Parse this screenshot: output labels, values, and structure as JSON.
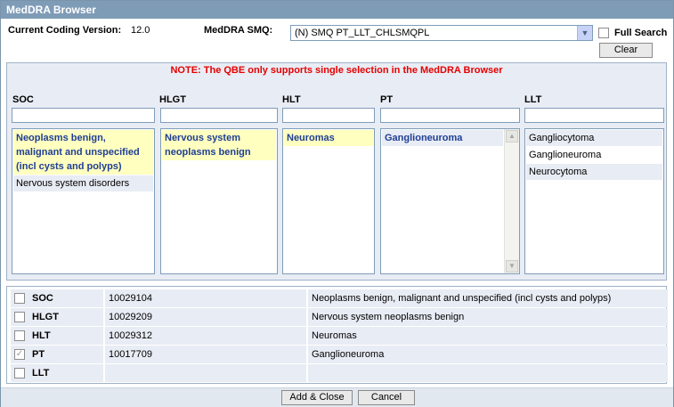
{
  "window": {
    "title": "MedDRA Browser"
  },
  "header": {
    "coding_version_label": "Current Coding Version:",
    "coding_version_value": "12.0",
    "smq_label": "MedDRA SMQ:",
    "smq_selected": "(N) SMQ PT_LLT_CHLSMQPL",
    "full_search_label": "Full Search",
    "clear_label": "Clear"
  },
  "browser": {
    "note": "NOTE: The QBE only supports single selection in the MedDRA Browser",
    "columns": {
      "soc": {
        "label": "SOC",
        "items": [
          "Neoplasms benign, malignant and unspecified (incl cysts and polyps)",
          "Nervous system disorders"
        ]
      },
      "hlgt": {
        "label": "HLGT",
        "items": [
          "Nervous system neoplasms benign"
        ]
      },
      "hlt": {
        "label": "HLT",
        "items": [
          "Neuromas"
        ]
      },
      "pt": {
        "label": "PT",
        "items": [
          "Ganglioneuroma"
        ]
      },
      "llt": {
        "label": "LLT",
        "items": [
          "Gangliocytoma",
          "Ganglioneuroma",
          "Neurocytoma"
        ]
      }
    }
  },
  "selection": {
    "rows": [
      {
        "level": "SOC",
        "code": "10029104",
        "name": "Neoplasms benign, malignant and unspecified (incl cysts and polyps)",
        "checked": false
      },
      {
        "level": "HLGT",
        "code": "10029209",
        "name": "Nervous system neoplasms benign",
        "checked": false
      },
      {
        "level": "HLT",
        "code": "10029312",
        "name": "Neuromas",
        "checked": false
      },
      {
        "level": "PT",
        "code": "10017709",
        "name": "Ganglioneuroma",
        "checked": true
      },
      {
        "level": "LLT",
        "code": "",
        "name": "",
        "checked": false
      }
    ]
  },
  "footer": {
    "add_close_label": "Add & Close",
    "cancel_label": "Cancel"
  },
  "icons": {
    "dropdown": "chevron-down-icon",
    "checkmark": "checkmark-icon",
    "scroll_up": "scroll-up-icon",
    "scroll_down": "scroll-down-icon"
  },
  "colors": {
    "titlebar": "#7f9cb7",
    "note": "#e60000",
    "selected_item_bg": "#ffffc0",
    "selected_item_text": "#1f3e94",
    "panel_bg": "#e8ecf4"
  }
}
